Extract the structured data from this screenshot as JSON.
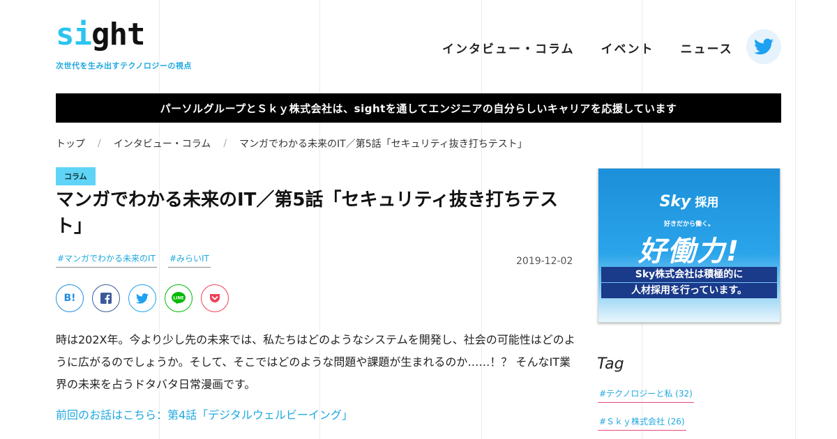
{
  "header": {
    "logo_text_a": "si",
    "logo_text_b": "ght",
    "tagline": "次世代を生み出すテクノロジーの視点",
    "nav": [
      "インタビュー・コラム",
      "イベント",
      "ニュース"
    ]
  },
  "banner": {
    "text": "パーソルグループとＳｋｙ株式会社は、sightを通してエンジニアの自分らしいキャリアを応援しています"
  },
  "breadcrumb": [
    "トップ",
    "インタビュー・コラム",
    "マンガでわかる未来のIT／第5話「セキュリティ抜き打ちテスト」"
  ],
  "article": {
    "category": "コラム",
    "title": "マンガでわかる未来のIT／第5話「セキュリティ抜き打ちテスト」",
    "tags": [
      "#マンガでわかる未来のIT",
      "#みらいIT"
    ],
    "date": "2019-12-02",
    "share": {
      "hatena": "B!"
    },
    "body": "時は202X年。今より少し先の未来では、私たちはどのようなシステムを開発し、社会の可能性はどのように広がるのでしょうか。そして、そこではどのような問題や課題が生まれるのか……！？ そんなIT業界の未来を占うドタバタ日常漫画です。",
    "prev_link": "前回のお話はこちら：第4話「デジタルウェルビーイング」"
  },
  "sidebar": {
    "ad": {
      "brand": "Sky",
      "brand_suffix": "採用",
      "sub": "好きだから働く。",
      "headline": "好働力!",
      "line1": "Sky株式会社は積極的に",
      "line2": "人材採用を行っています。"
    },
    "tag_heading": "Tag",
    "tags": [
      {
        "label": "#テクノロジーと私",
        "count": "(32)"
      },
      {
        "label": "#Ｓｋｙ株式会社",
        "count": "(26)"
      }
    ]
  },
  "colors": {
    "accent": "#1fa8e0",
    "logo_cyan": "#29c4f0",
    "category_bg": "#5fd4f6",
    "banner_bg": "#000000"
  }
}
